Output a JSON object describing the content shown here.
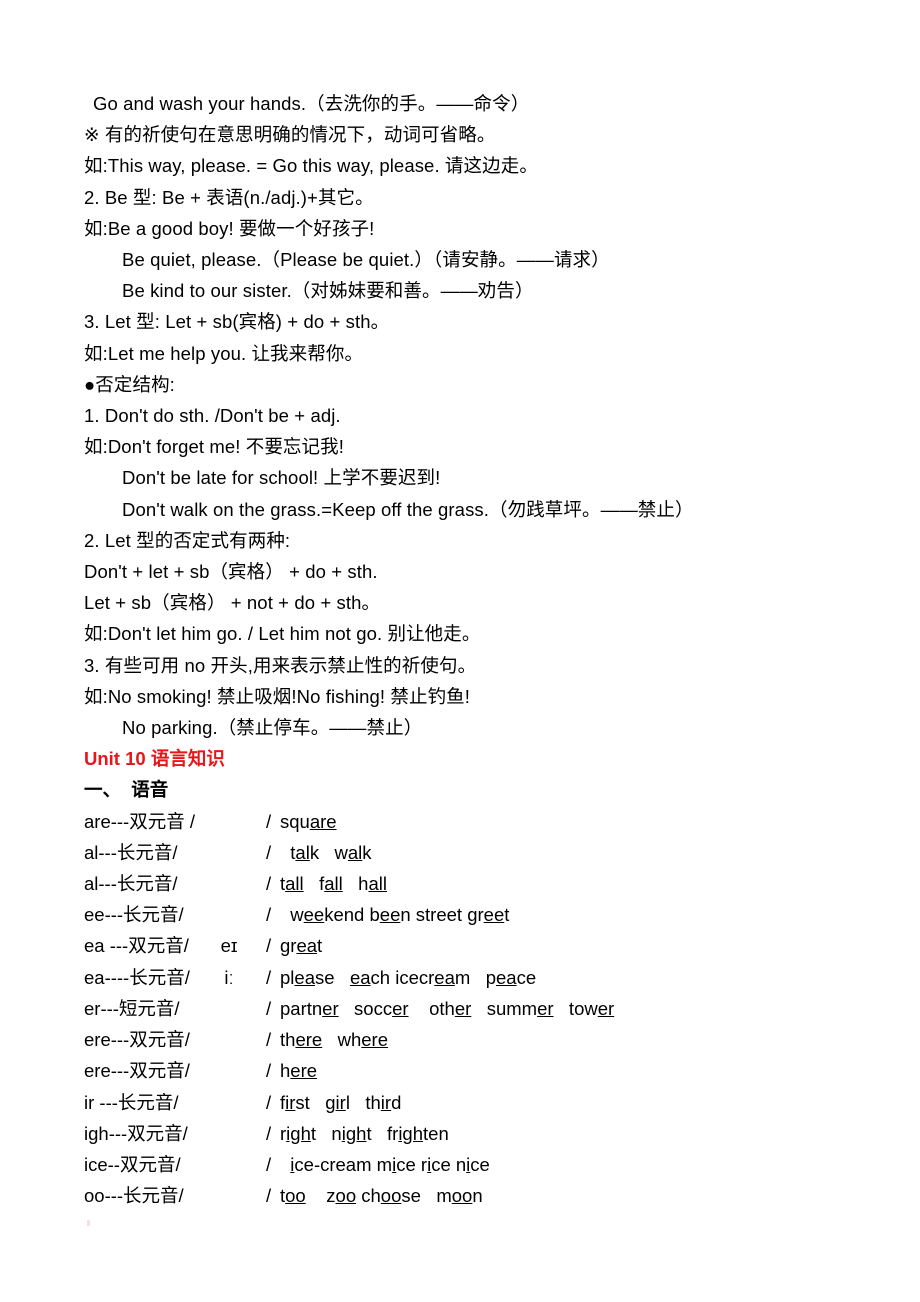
{
  "document": {
    "body_lines": [
      {
        "indent": 1,
        "text": "Go and wash your hands.（去洗你的手。——命令）"
      },
      {
        "indent": 0,
        "text": "※ 有的祈使句在意思明确的情况下，动词可省略。"
      },
      {
        "indent": 0,
        "text": "如:This way, please. = Go this way, please. 请这边走。"
      },
      {
        "indent": 0,
        "text": "2. Be 型: Be + 表语(n./adj.)+其它。"
      },
      {
        "indent": 0,
        "text": "如:Be a good boy! 要做一个好孩子!"
      },
      {
        "indent": 2,
        "text": "Be quiet, please.（Please be quiet.）（请安静。——请求）"
      },
      {
        "indent": 2,
        "text": "Be kind to our sister.（对姊妹要和善。——劝告）"
      },
      {
        "indent": 0,
        "text": "3. Let 型: Let + sb(宾格) + do + sth。"
      },
      {
        "indent": 0,
        "text": "如:Let me help you. 让我来帮你。"
      },
      {
        "indent": 0,
        "text": "●否定结构:"
      },
      {
        "indent": 0,
        "text": "1. Don't do sth. /Don't be + adj."
      },
      {
        "indent": 0,
        "text": "如:Don't forget me! 不要忘记我!"
      },
      {
        "indent": 2,
        "text": "Don't be late for school! 上学不要迟到!"
      },
      {
        "indent": 2,
        "text": "Don't walk on the grass.=Keep off the grass.（勿践草坪。——禁止）"
      },
      {
        "indent": 0,
        "text": "2. Let 型的否定式有两种:"
      },
      {
        "indent": 0,
        "text": "Don't + let + sb（宾格） + do + sth."
      },
      {
        "indent": 0,
        "text": "Let + sb（宾格） + not + do + sth。"
      },
      {
        "indent": 0,
        "text": "如:Don't let him go. / Let him not go. 别让他走。"
      },
      {
        "indent": 0,
        "text": "3. 有些可用 no 开头,用来表示禁止性的祈使句。"
      },
      {
        "indent": 0,
        "text": "如:No smoking! 禁止吸烟!No fishing! 禁止钓鱼!"
      },
      {
        "indent": 2,
        "text": "No parking.（禁止停车。——禁止）"
      }
    ],
    "unit_heading": "Unit 10 语言知识",
    "section_heading": "一、  语音",
    "phonetics": [
      {
        "key": "are---双元音 /",
        "ipa": "",
        "close": "/",
        "words": [
          {
            "pre": "squ",
            "mark": "are",
            "post": ""
          }
        ]
      },
      {
        "key": "al---长元音/",
        "ipa": "",
        "close": "/",
        "words": [
          {
            "pre": "  t",
            "mark": "al",
            "post": "k"
          },
          {
            "pre": "   w",
            "mark": "al",
            "post": "k"
          }
        ]
      },
      {
        "key": "al---长元音/",
        "ipa": "",
        "close": "/",
        "words": [
          {
            "pre": "t",
            "mark": "all",
            "post": ""
          },
          {
            "pre": "   f",
            "mark": "all",
            "post": ""
          },
          {
            "pre": "   h",
            "mark": "all",
            "post": ""
          }
        ]
      },
      {
        "key": "ee---长元音/",
        "ipa": "",
        "close": "/",
        "words": [
          {
            "pre": "  w",
            "mark": "ee",
            "post": "kend"
          },
          {
            "pre": " b",
            "mark": "ee",
            "post": "n"
          },
          {
            "pre": " street",
            "mark": "",
            "post": ""
          },
          {
            "pre": " gr",
            "mark": "ee",
            "post": "t"
          }
        ]
      },
      {
        "key": "ea ---双元音/",
        "ipa": "eɪ",
        "close": "/",
        "words": [
          {
            "pre": "gr",
            "mark": "ea",
            "post": "t"
          }
        ]
      },
      {
        "key": "ea----长元音/",
        "ipa": "iː",
        "close": "/",
        "words": [
          {
            "pre": "pl",
            "mark": "ea",
            "post": "se"
          },
          {
            "pre": "   ",
            "mark": "ea",
            "post": "ch"
          },
          {
            "pre": " icecr",
            "mark": "ea",
            "post": "m"
          },
          {
            "pre": "   p",
            "mark": "ea",
            "post": "ce"
          }
        ]
      },
      {
        "key": "er---短元音/",
        "ipa": "",
        "close": "/",
        "words": [
          {
            "pre": "partn",
            "mark": "er",
            "post": ""
          },
          {
            "pre": "   socc",
            "mark": "er",
            "post": ""
          },
          {
            "pre": "    oth",
            "mark": "er",
            "post": ""
          },
          {
            "pre": "   summ",
            "mark": "er",
            "post": ""
          },
          {
            "pre": "   tow",
            "mark": "er",
            "post": ""
          }
        ]
      },
      {
        "key": "ere---双元音/",
        "ipa": "",
        "close": "/",
        "words": [
          {
            "pre": "th",
            "mark": "ere",
            "post": ""
          },
          {
            "pre": "   wh",
            "mark": "ere",
            "post": ""
          }
        ]
      },
      {
        "key": "ere---双元音/",
        "ipa": "",
        "close": "/",
        "words": [
          {
            "pre": "h",
            "mark": "ere",
            "post": ""
          }
        ]
      },
      {
        "key": "ir ---长元音/",
        "ipa": "",
        "close": "/",
        "words": [
          {
            "pre": "f",
            "mark": "ir",
            "post": "st"
          },
          {
            "pre": "   g",
            "mark": "ir",
            "post": "l"
          },
          {
            "pre": "   th",
            "mark": "ir",
            "post": "d"
          }
        ]
      },
      {
        "key": "igh---双元音/",
        "ipa": "",
        "close": "/",
        "words": [
          {
            "pre": "r",
            "mark": "igh",
            "post": "t"
          },
          {
            "pre": "   n",
            "mark": "igh",
            "post": "t"
          },
          {
            "pre": "   fr",
            "mark": "igh",
            "post": "ten"
          }
        ]
      },
      {
        "key": "ice--双元音/",
        "ipa": "",
        "close": "/",
        "words": [
          {
            "pre": "  ",
            "mark": "i",
            "post": "ce-cream"
          },
          {
            "pre": " m",
            "mark": "i",
            "post": "ce"
          },
          {
            "pre": " r",
            "mark": "i",
            "post": "ce"
          },
          {
            "pre": " n",
            "mark": "i",
            "post": "ce"
          }
        ]
      },
      {
        "key": "oo---长元音/",
        "ipa": "",
        "close": "/",
        "words": [
          {
            "pre": "t",
            "mark": "oo",
            "post": ""
          },
          {
            "pre": "    z",
            "mark": "oo",
            "post": ""
          },
          {
            "pre": " ch",
            "mark": "oo",
            "post": "se"
          },
          {
            "pre": "   m",
            "mark": "oo",
            "post": "n"
          }
        ]
      }
    ]
  },
  "colors": {
    "heading_red": "#e8161a",
    "text_black": "#000000",
    "page_background": "#ffffff"
  }
}
